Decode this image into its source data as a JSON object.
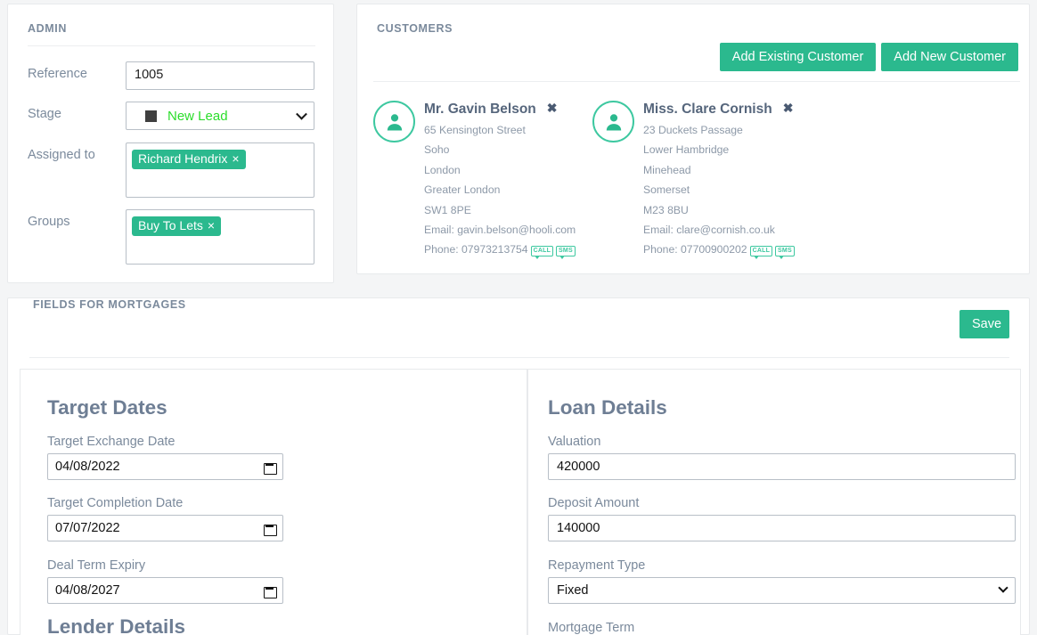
{
  "admin": {
    "title": "ADMIN",
    "reference_label": "Reference",
    "reference_value": "1005",
    "stage_label": "Stage",
    "stage_value": "New Lead",
    "stage_swatch_color": "#3f3f3f",
    "stage_text_color": "#2bdd2b",
    "assigned_label": "Assigned to",
    "assigned_tags": [
      "Richard Hendrix"
    ],
    "groups_label": "Groups",
    "groups_tags": [
      "Buy To Lets"
    ],
    "tag_remove_glyph": "×"
  },
  "customers": {
    "title": "CUSTOMERS",
    "add_existing_label": "Add Existing Customer",
    "add_new_label": "Add New Customer",
    "remove_glyph": "✖",
    "list": [
      {
        "name": "Mr. Gavin Belson",
        "address_1": "65 Kensington Street",
        "address_2": "Soho",
        "address_3": "London",
        "address_4": "Greater London",
        "postcode": "SW1 8PE",
        "email": "Email: gavin.belson@hooli.com",
        "phone": "Phone: 07973213754",
        "call_badge": "CALL",
        "sms_badge": "SMS"
      },
      {
        "name": "Miss. Clare Cornish",
        "address_1": "23 Duckets Passage",
        "address_2": "Lower Hambridge",
        "address_3": "Minehead",
        "address_4": "Somerset",
        "postcode": "M23 8BU",
        "email": "Email: clare@cornish.co.uk",
        "phone": "Phone: 07700900202",
        "call_badge": "CALL",
        "sms_badge": "SMS"
      }
    ]
  },
  "fields": {
    "title": "FIELDS FOR MORTGAGES",
    "save_label": "Save",
    "target_dates": {
      "heading": "Target Dates",
      "exchange_label": "Target Exchange Date",
      "exchange_value": "04/08/2022",
      "completion_label": "Target Completion Date",
      "completion_value": "07/07/2022",
      "deal_expiry_label": "Deal Term Expiry",
      "deal_expiry_value": "04/08/2027"
    },
    "lender_details": {
      "heading": "Lender Details"
    },
    "loan_details": {
      "heading": "Loan Details",
      "valuation_label": "Valuation",
      "valuation_value": "420000",
      "deposit_label": "Deposit Amount",
      "deposit_value": "140000",
      "repayment_label": "Repayment Type",
      "repayment_value": "Fixed",
      "mortgage_term_label": "Mortgage Term"
    }
  },
  "theme": {
    "accent_green": "#2bb98e",
    "avatar_green": "#3dc8a0",
    "label_grey": "#7b8a9c",
    "heading_grey": "#6e7e94",
    "page_bg": "#f4f5f6"
  }
}
